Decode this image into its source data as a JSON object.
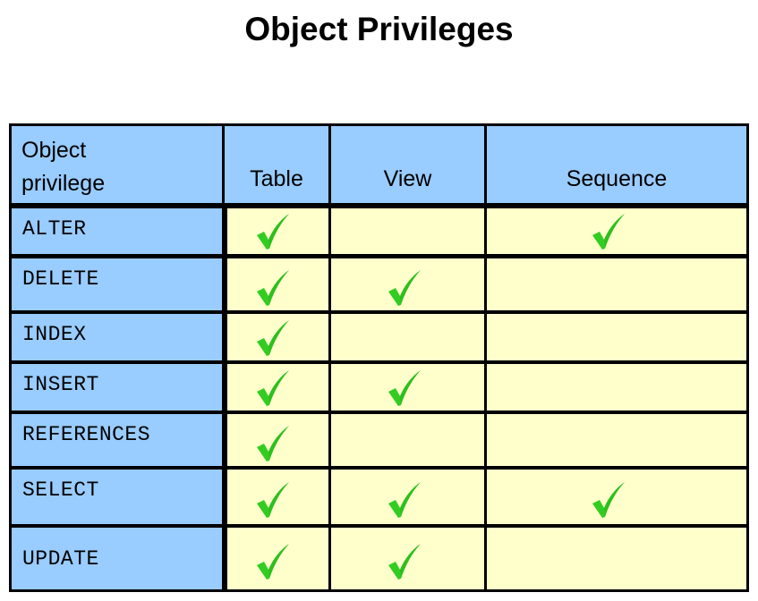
{
  "title": "Object Privileges",
  "colors": {
    "header_bg": "#99CCFF",
    "cell_bg": "#FFFFCC",
    "check": "#33CC22",
    "grid_lines": "#000000"
  },
  "table": {
    "columns": [
      {
        "label": "Object privilege",
        "label_lines": [
          "Object",
          "privilege"
        ]
      },
      {
        "label": "Table"
      },
      {
        "label": "View"
      },
      {
        "label": "Sequence"
      }
    ],
    "rows": [
      {
        "privilege": "ALTER",
        "table": true,
        "view": false,
        "sequence": true
      },
      {
        "privilege": "DELETE",
        "table": true,
        "view": true,
        "sequence": false
      },
      {
        "privilege": "INDEX",
        "table": true,
        "view": false,
        "sequence": false
      },
      {
        "privilege": "INSERT",
        "table": true,
        "view": true,
        "sequence": false
      },
      {
        "privilege": "REFERENCES",
        "table": true,
        "view": false,
        "sequence": false
      },
      {
        "privilege": "SELECT",
        "table": true,
        "view": true,
        "sequence": true
      },
      {
        "privilege": "UPDATE",
        "table": true,
        "view": true,
        "sequence": false
      }
    ],
    "check_icon": "checkmark-icon"
  }
}
